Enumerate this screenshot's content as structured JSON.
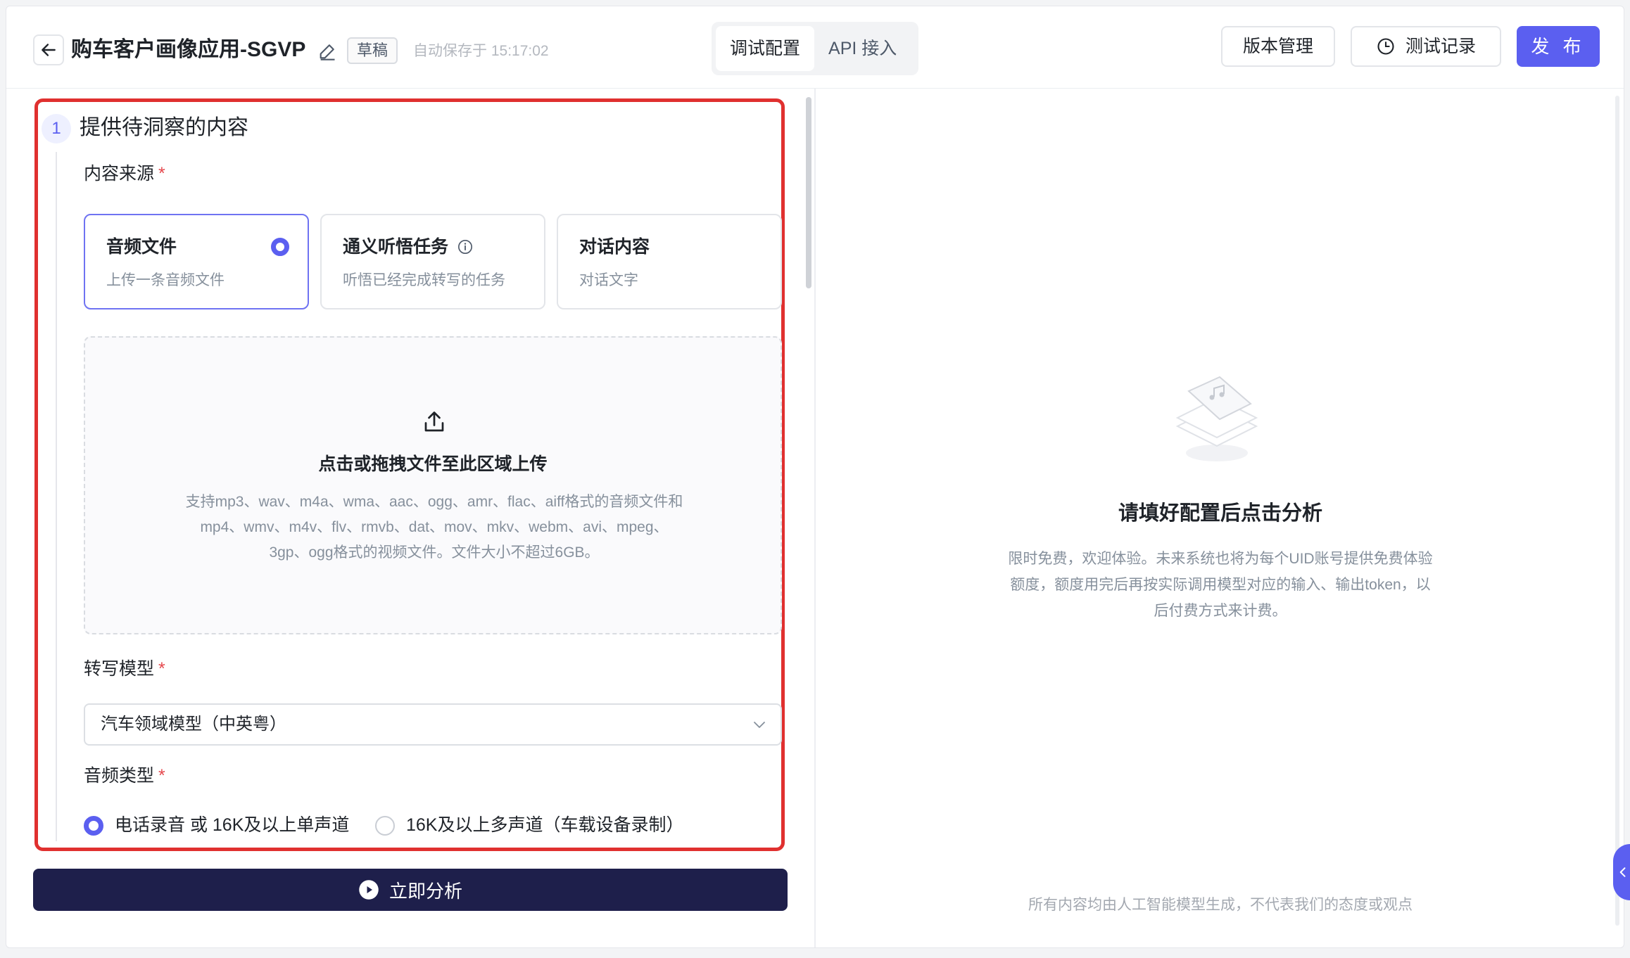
{
  "header": {
    "title": "购车客户画像应用-SGVP",
    "draft_badge": "草稿",
    "autosave": "自动保存于 15:17:02",
    "tabs": [
      {
        "label": "调试配置",
        "active": true
      },
      {
        "label": "API 接入",
        "active": false
      }
    ],
    "version_button": "版本管理",
    "test_button": "测试记录",
    "publish_button": "发 布"
  },
  "section": {
    "step": "1",
    "title": "提供待洞察的内容",
    "content_source_label": "内容来源",
    "required_mark": "*",
    "sources": [
      {
        "title": "音频文件",
        "desc": "上传一条音频文件",
        "selected": true
      },
      {
        "title": "通义听悟任务",
        "desc": "听悟已经完成转写的任务",
        "selected": false
      },
      {
        "title": "对话内容",
        "desc": "对话文字",
        "selected": false
      }
    ],
    "upload": {
      "title": "点击或拖拽文件至此区域上传",
      "desc": "支持mp3、wav、m4a、wma、aac、ogg、amr、flac、aiff格式的音频文件和mp4、wmv、m4v、flv、rmvb、dat、mov、mkv、webm、avi、mpeg、3gp、ogg格式的视频文件。文件大小不超过6GB。"
    },
    "model_label": "转写模型",
    "model_value": "汽车领域模型（中英粤）",
    "audio_type_label": "音频类型",
    "audio_types": [
      {
        "label": "电话录音 或 16K及以上单声道",
        "selected": true
      },
      {
        "label": "16K及以上多声道（车载设备录制）",
        "selected": false
      }
    ]
  },
  "analyze_button": "立即分析",
  "right": {
    "empty_title": "请填好配置后点击分析",
    "empty_desc": "限时免费，欢迎体验。未来系统也将为每个UID账号提供免费体验额度，额度用完后再按实际调用模型对应的输入、输出token，以后付费方式来计费。",
    "footer_note": "所有内容均由人工智能模型生成，不代表我们的态度或观点"
  },
  "colors": {
    "accent": "#5b5ff0",
    "highlight_border": "#e0302f",
    "primary_dark": "#1e1f4b"
  }
}
